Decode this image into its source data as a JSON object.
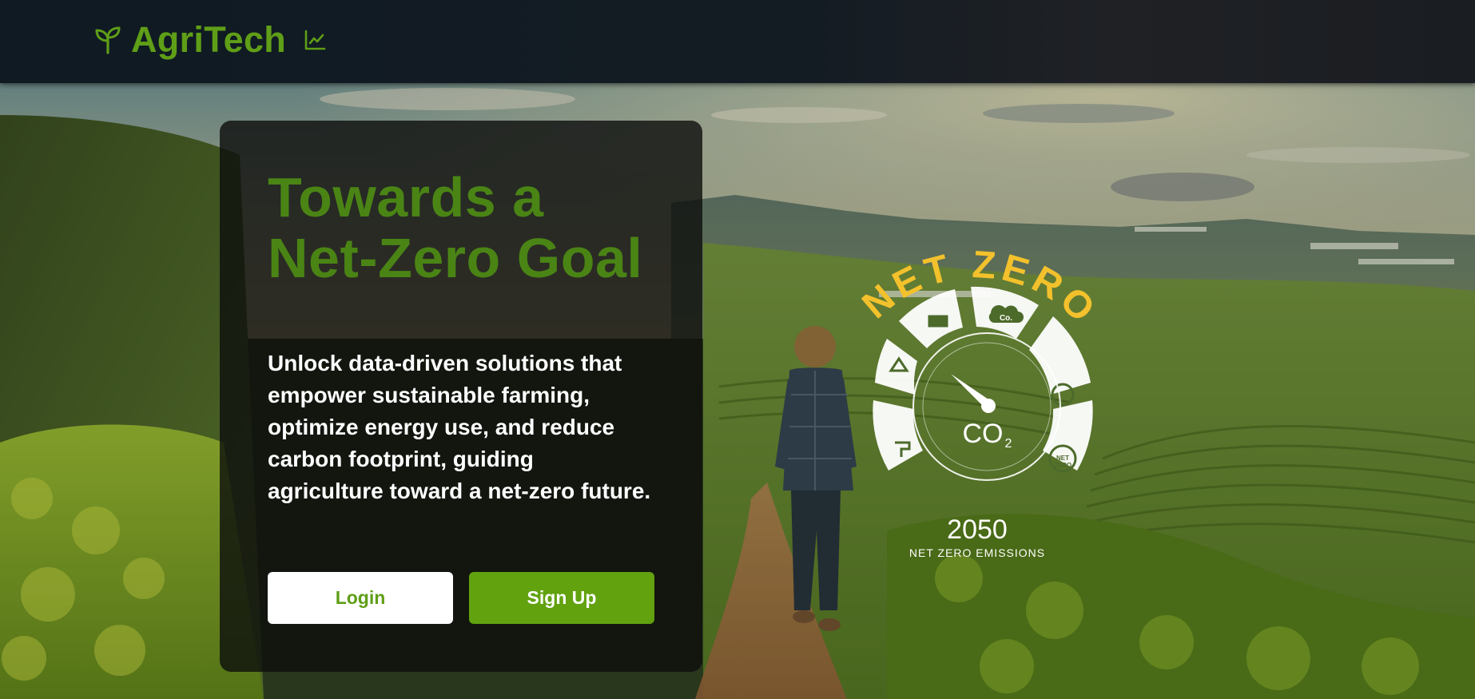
{
  "brand": {
    "name": "AgriTech",
    "leaf_icon": "sprout-icon",
    "chart_icon": "line-chart-icon",
    "color": "#5f9e17"
  },
  "hero": {
    "headline": "Towards a Net-Zero Goal",
    "subtext": "Unlock data-driven solutions that empower sustainable farming, optimize energy use, and reduce carbon footprint, guiding agriculture toward a net-zero future.",
    "headline_color": "#4a8415"
  },
  "buttons": {
    "login_label": "Login",
    "signup_label": "Sign Up",
    "accent": "#62a20f"
  },
  "emblem": {
    "arc_text": "NET ZERO",
    "gauge_label_main": "CO",
    "gauge_label_sub": "2",
    "cloud_label": "Co.",
    "badge_line1": "NET",
    "badge_line2": "ZERO",
    "year": "2050",
    "caption": "NET ZERO EMISSIONS",
    "segment_icons": [
      "recycle-icon",
      "factory-icon",
      "co2-cloud-icon",
      "globe-icon",
      "net-zero-leaf-icon",
      "water-tap-icon"
    ],
    "arc_text_color": "#f3c12c"
  }
}
